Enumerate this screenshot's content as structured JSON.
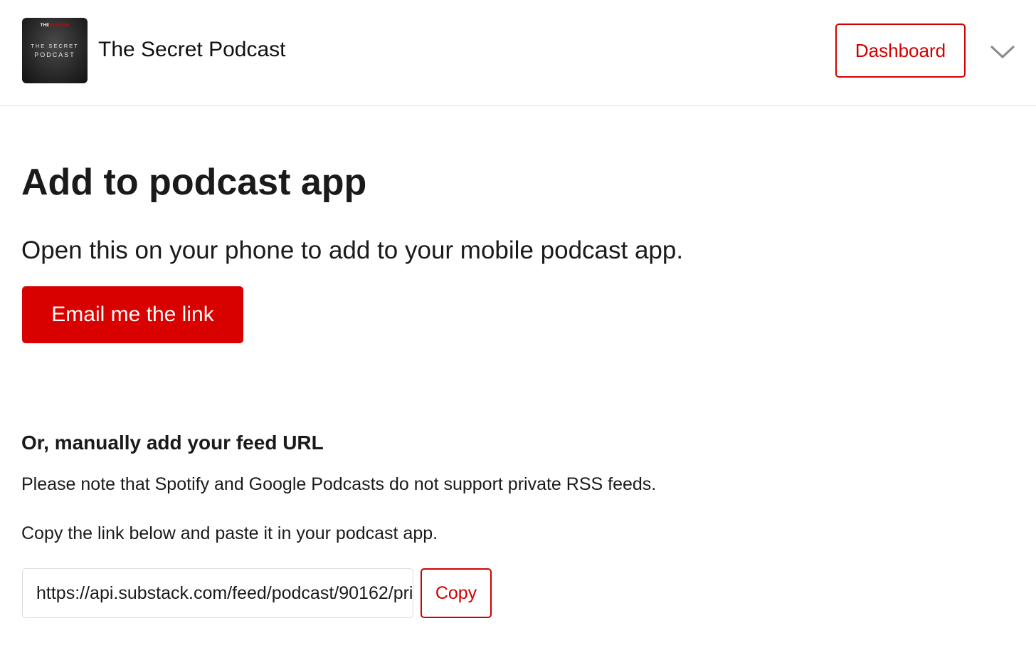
{
  "header": {
    "logo": {
      "brand_prefix": "THE",
      "brand_suffix": "BUDMAN",
      "line1": "THE SECRET",
      "line2": "PODCAST"
    },
    "title": "The Secret Podcast",
    "dashboard_label": "Dashboard",
    "menu_icon": "chevron-down-icon"
  },
  "main": {
    "heading": "Add to podcast app",
    "subtitle": "Open this on your phone to add to your mobile podcast app.",
    "email_button_label": "Email me the link",
    "manual": {
      "heading": "Or, manually add your feed URL",
      "note": "Please note that Spotify and Google Podcasts do not support private RSS feeds.",
      "instruction": "Copy the link below and paste it in your podcast app.",
      "feed_url": "https://api.substack.com/feed/podcast/90162/pri",
      "copy_label": "Copy"
    }
  },
  "colors": {
    "accent": "#d00000",
    "text": "#1a1a1a",
    "divider": "#e4e4e4"
  }
}
